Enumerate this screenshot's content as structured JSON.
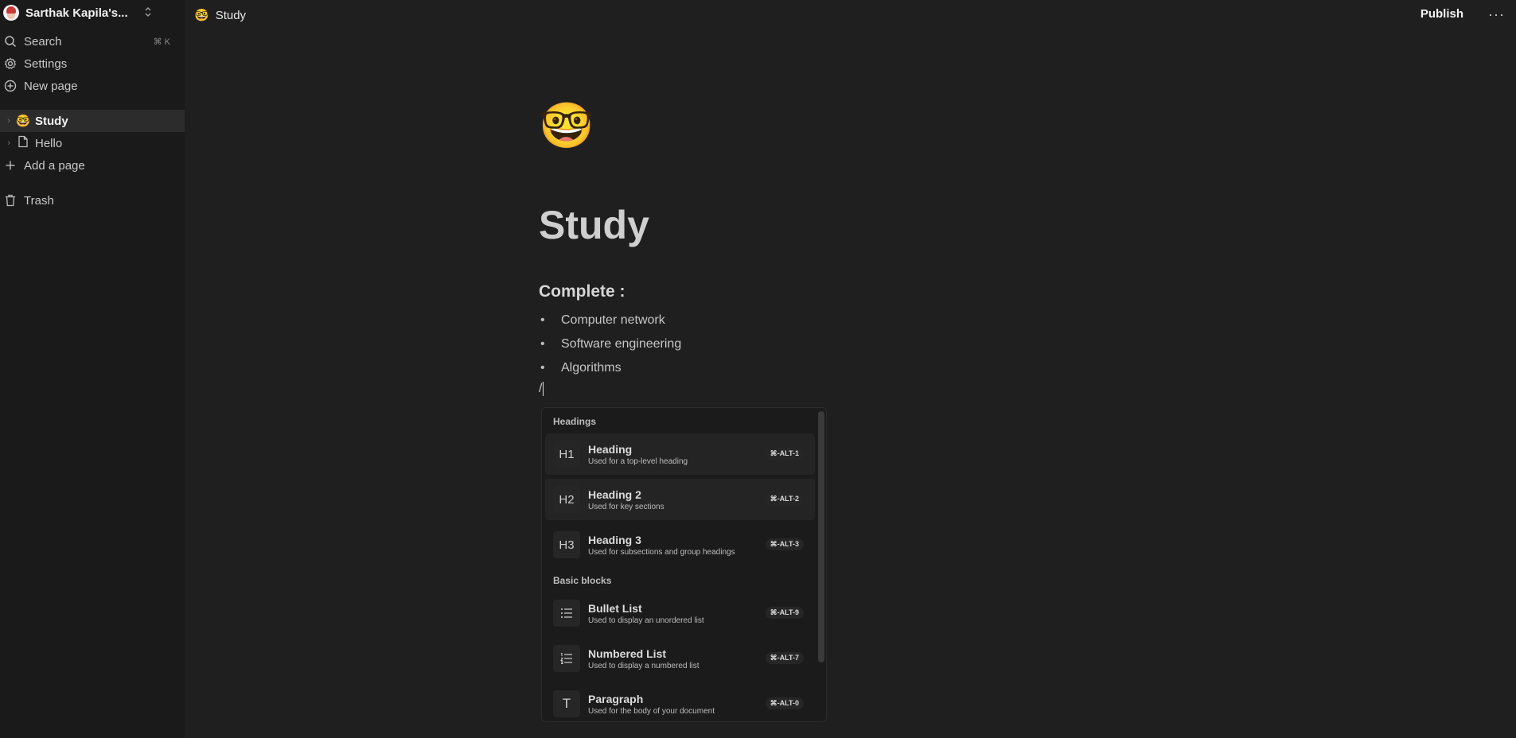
{
  "workspace": {
    "name": "Sarthak Kapila's...",
    "chevron_icon": "chevron-up-down-icon"
  },
  "sidebar": {
    "search": {
      "label": "Search",
      "shortcut": "⌘ K"
    },
    "settings": {
      "label": "Settings"
    },
    "new_page": {
      "label": "New page"
    },
    "pages": [
      {
        "emoji": "🤓",
        "label": "Study"
      },
      {
        "icon": "document-icon",
        "label": "Hello"
      }
    ],
    "add_page": {
      "label": "Add a page"
    },
    "trash": {
      "label": "Trash"
    }
  },
  "header": {
    "emoji": "🤓",
    "title": "Study",
    "publish": "Publish",
    "more": "···"
  },
  "page": {
    "emoji": "🤓",
    "title": "Study",
    "subheading": "Complete :",
    "bullet_marker": "•",
    "bullets": [
      "Computer network",
      "Software engineering",
      "Algorithms"
    ],
    "slash_input": "/"
  },
  "slash_menu": {
    "groups": [
      {
        "label": "Headings",
        "items": [
          {
            "icon_text": "H1",
            "title": "Heading",
            "desc": "Used for a top-level heading",
            "shortcut": "⌘-ALT-1"
          },
          {
            "icon_text": "H2",
            "title": "Heading 2",
            "desc": "Used for key sections",
            "shortcut": "⌘-ALT-2"
          },
          {
            "icon_text": "H3",
            "title": "Heading 3",
            "desc": "Used for subsections and group headings",
            "shortcut": "⌘-ALT-3"
          }
        ]
      },
      {
        "label": "Basic blocks",
        "items": [
          {
            "icon_text": "",
            "title": "Bullet List",
            "desc": "Used to display an unordered list",
            "shortcut": "⌘-ALT-9"
          },
          {
            "icon_text": "",
            "title": "Numbered List",
            "desc": "Used to display a numbered list",
            "shortcut": "⌘-ALT-7"
          },
          {
            "icon_text": "T",
            "title": "Paragraph",
            "desc": "Used for the body of your document",
            "shortcut": "⌘-ALT-0"
          }
        ]
      }
    ]
  }
}
